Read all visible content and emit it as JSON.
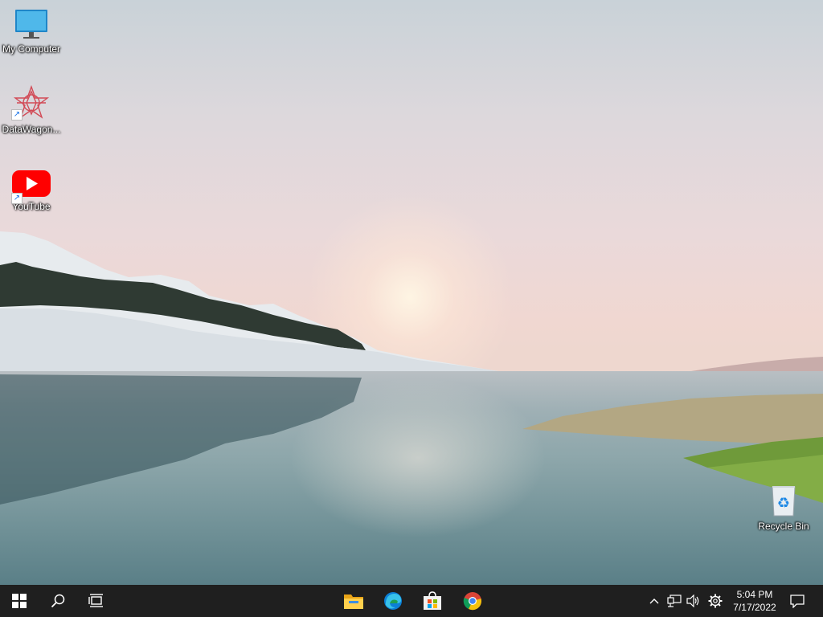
{
  "desktop": {
    "icons": [
      {
        "label": "My Computer",
        "icon": "monitor-icon"
      },
      {
        "label": "DataWagon...",
        "icon": "datawagon-app-icon"
      },
      {
        "label": "YouTube",
        "icon": "youtube-icon"
      },
      {
        "label": "Recycle Bin",
        "icon": "recycle-bin-icon"
      }
    ]
  },
  "taskbar": {
    "buttons": [
      {
        "name": "start",
        "icon": "windows-logo-icon"
      },
      {
        "name": "search",
        "icon": "search-icon"
      },
      {
        "name": "task-view",
        "icon": "task-view-icon"
      }
    ],
    "pinned": [
      {
        "name": "file-explorer",
        "icon": "folder-icon"
      },
      {
        "name": "edge",
        "icon": "edge-icon"
      },
      {
        "name": "store",
        "icon": "store-icon"
      },
      {
        "name": "chrome",
        "icon": "chrome-icon"
      }
    ],
    "tray": {
      "icons": [
        "chevron-up-icon",
        "network-icon",
        "volume-icon",
        "settings-gear-icon"
      ],
      "time": "5:04 PM",
      "date": "7/17/2022",
      "notification_icon": "notification-icon"
    }
  }
}
